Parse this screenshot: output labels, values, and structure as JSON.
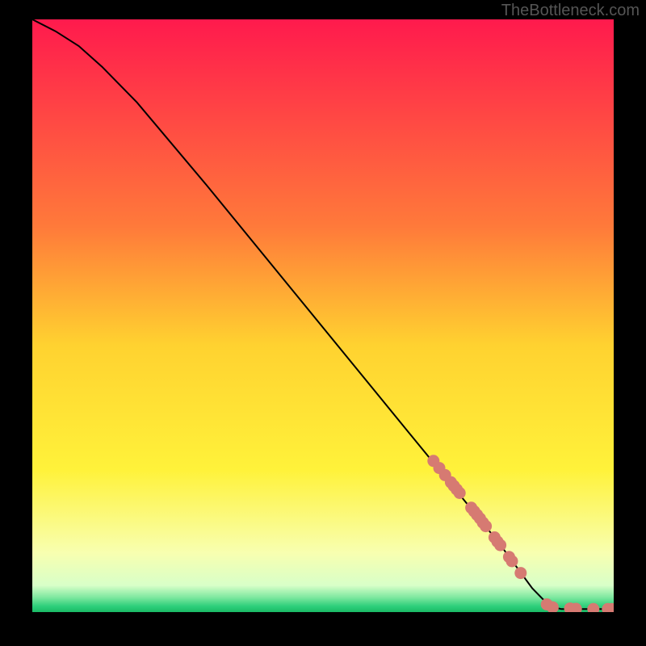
{
  "watermark": "TheBottleneck.com",
  "chart_data": {
    "type": "line",
    "xlim": [
      0,
      100
    ],
    "ylim": [
      0,
      100
    ],
    "title": "",
    "xlabel": "",
    "ylabel": "",
    "curve": [
      {
        "x": 0,
        "y": 100
      },
      {
        "x": 4,
        "y": 98
      },
      {
        "x": 8,
        "y": 95.5
      },
      {
        "x": 12,
        "y": 92
      },
      {
        "x": 18,
        "y": 86
      },
      {
        "x": 30,
        "y": 72
      },
      {
        "x": 45,
        "y": 54
      },
      {
        "x": 60,
        "y": 36
      },
      {
        "x": 70,
        "y": 24
      },
      {
        "x": 80,
        "y": 12
      },
      {
        "x": 86,
        "y": 4
      },
      {
        "x": 89,
        "y": 1
      },
      {
        "x": 91,
        "y": 0.5
      },
      {
        "x": 100,
        "y": 0.5
      }
    ],
    "markers": [
      {
        "x": 69,
        "y": 25.5
      },
      {
        "x": 70,
        "y": 24.3
      },
      {
        "x": 71,
        "y": 23.1
      },
      {
        "x": 72,
        "y": 21.9
      },
      {
        "x": 72.5,
        "y": 21.3
      },
      {
        "x": 73,
        "y": 20.7
      },
      {
        "x": 73.5,
        "y": 20.1
      },
      {
        "x": 75.5,
        "y": 17.6
      },
      {
        "x": 76,
        "y": 17.0
      },
      {
        "x": 76.5,
        "y": 16.4
      },
      {
        "x": 77,
        "y": 15.8
      },
      {
        "x": 77.5,
        "y": 15.1
      },
      {
        "x": 78,
        "y": 14.5
      },
      {
        "x": 79.5,
        "y": 12.6
      },
      {
        "x": 80,
        "y": 11.9
      },
      {
        "x": 80.5,
        "y": 11.3
      },
      {
        "x": 82,
        "y": 9.3
      },
      {
        "x": 82.5,
        "y": 8.6
      },
      {
        "x": 84,
        "y": 6.6
      },
      {
        "x": 88.5,
        "y": 1.3
      },
      {
        "x": 89.5,
        "y": 0.8
      },
      {
        "x": 92.5,
        "y": 0.6
      },
      {
        "x": 93.5,
        "y": 0.55
      },
      {
        "x": 96.5,
        "y": 0.5
      },
      {
        "x": 99,
        "y": 0.5
      },
      {
        "x": 99.7,
        "y": 0.5
      }
    ],
    "marker_color": "#d67a72",
    "curve_color": "#000000",
    "gradient_stops": [
      {
        "offset": 0.0,
        "color": "#ff1a4d"
      },
      {
        "offset": 0.35,
        "color": "#ff7a3a"
      },
      {
        "offset": 0.55,
        "color": "#ffd230"
      },
      {
        "offset": 0.76,
        "color": "#fff23a"
      },
      {
        "offset": 0.9,
        "color": "#f8ffb0"
      },
      {
        "offset": 0.955,
        "color": "#d8ffc8"
      },
      {
        "offset": 0.975,
        "color": "#7fe8a0"
      },
      {
        "offset": 0.99,
        "color": "#2ecf7b"
      },
      {
        "offset": 1.0,
        "color": "#1abb66"
      }
    ]
  }
}
